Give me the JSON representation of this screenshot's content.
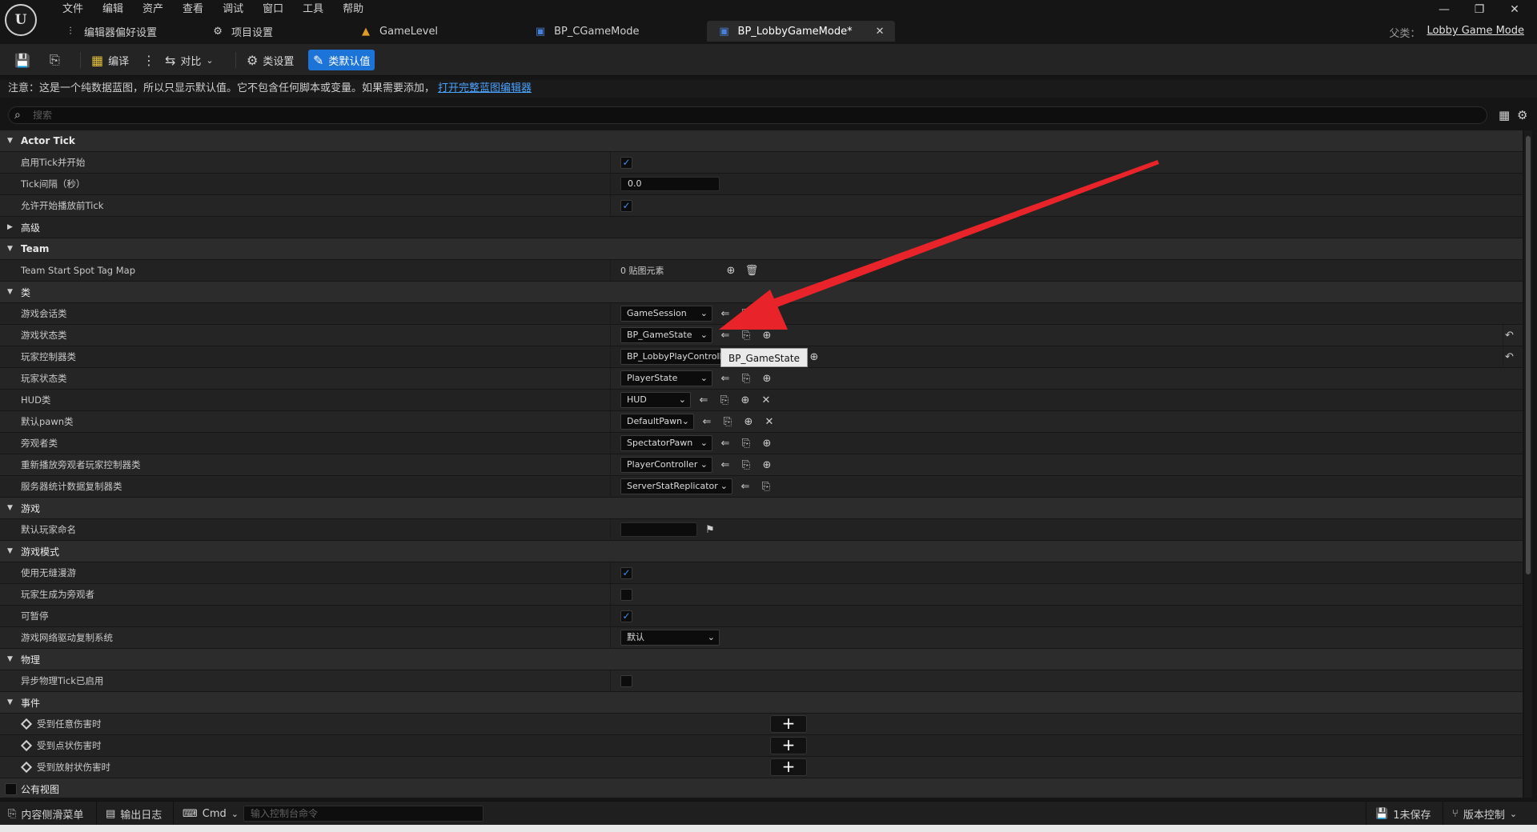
{
  "logo": "U",
  "menu": [
    "文件",
    "编辑",
    "资产",
    "查看",
    "调试",
    "窗口",
    "工具",
    "帮助"
  ],
  "window_controls": [
    "—",
    "❐",
    "✕"
  ],
  "tabs": [
    {
      "label": "编辑器偏好设置",
      "icon": "sliders-icon",
      "active": false
    },
    {
      "label": "项目设置",
      "icon": "gear-icon",
      "active": false
    },
    {
      "label": "GameLevel",
      "icon": "level-icon",
      "active": false
    },
    {
      "label": "BP_CGameMode",
      "icon": "blueprint-icon",
      "active": false
    },
    {
      "label": "BP_LobbyGameMode*",
      "icon": "blueprint-icon",
      "active": true
    }
  ],
  "parent": {
    "label": "父类：",
    "value": "Lobby Game Mode"
  },
  "toolbar": {
    "compile": "编译",
    "diff": "对比",
    "class_settings": "类设置",
    "class_defaults": "类默认值"
  },
  "notice": {
    "text": "注意：这是一个纯数据蓝图，所以只显示默认值。它不包含任何脚本或变量。如果需要添加，",
    "link": "打开完整蓝图编辑器"
  },
  "search": {
    "placeholder": "搜索"
  },
  "sections": {
    "actor_tick": "Actor Tick",
    "advanced": "高级",
    "team": "Team",
    "class": "类",
    "game": "游戏",
    "game_mode": "游戏模式",
    "physics": "物理",
    "events": "事件",
    "public_view": "公有视图"
  },
  "props": {
    "tick_enabled": {
      "label": "启用Tick并开始",
      "checked": true
    },
    "tick_interval": {
      "label": "Tick间隔（秒）",
      "value": "0.0"
    },
    "tick_before_begin": {
      "label": "允许开始播放前Tick",
      "checked": true
    },
    "team_start_spot": {
      "label": "Team Start Spot Tag Map",
      "value": "0 贴图元素"
    },
    "game_session": {
      "label": "游戏会话类",
      "value": "GameSession"
    },
    "game_state": {
      "label": "游戏状态类",
      "value": "BP_GameState"
    },
    "player_controller": {
      "label": "玩家控制器类",
      "value": "BP_LobbyPlayControlle"
    },
    "player_state": {
      "label": "玩家状态类",
      "value": "PlayerState"
    },
    "hud": {
      "label": "HUD类",
      "value": "HUD"
    },
    "default_pawn": {
      "label": "默认pawn类",
      "value": "DefaultPawn"
    },
    "spectator": {
      "label": "旁观者类",
      "value": "SpectatorPawn"
    },
    "replay_spectator": {
      "label": "重新播放旁观者玩家控制器类",
      "value": "PlayerController"
    },
    "server_stat": {
      "label": "服务器统计数据复制器类",
      "value": "ServerStatReplicator"
    },
    "default_player_name": {
      "label": "默认玩家命名",
      "value": ""
    },
    "seamless_travel": {
      "label": "使用无缝漫游",
      "checked": true
    },
    "start_spectator": {
      "label": "玩家生成为旁观者",
      "checked": false
    },
    "pausable": {
      "label": "可暂停",
      "checked": true
    },
    "net_driver": {
      "label": "游戏网络驱动复制系统",
      "value": "默认"
    },
    "async_physics": {
      "label": "异步物理Tick已启用",
      "checked": false
    },
    "any_damage": {
      "label": "受到任意伤害时"
    },
    "point_damage": {
      "label": "受到点状伤害时"
    },
    "radial_damage": {
      "label": "受到放射状伤害时"
    }
  },
  "tooltip": "BP_GameState",
  "statusbar": {
    "content_drawer": "内容侧滑菜单",
    "output_log": "输出日志",
    "cmd": "Cmd",
    "console_placeholder": "输入控制台命令",
    "unsaved": "1未保存",
    "source_control": "版本控制"
  },
  "colors": {
    "accent": "#1d74d8",
    "check": "#3a8ff0",
    "annotation_arrow": "#e8242a",
    "link": "#4aa3ff"
  }
}
